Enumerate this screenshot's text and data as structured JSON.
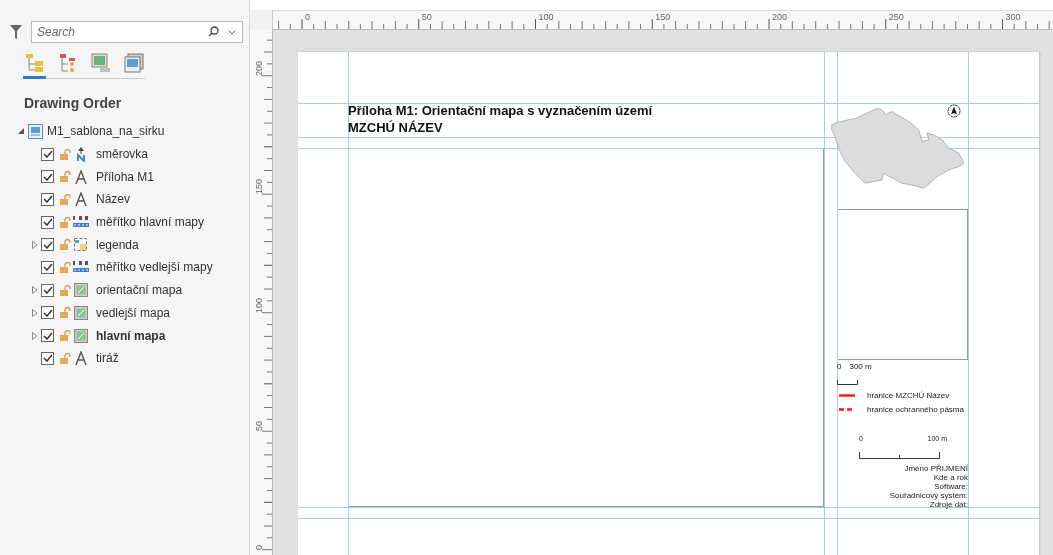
{
  "search": {
    "placeholder": "Search"
  },
  "view_tabs": [
    {
      "kind": "drawing-order",
      "selected": true
    },
    {
      "kind": "selection",
      "selected": false
    },
    {
      "kind": "map-view",
      "selected": false
    },
    {
      "kind": "layout-view",
      "selected": false
    }
  ],
  "section_title": "Drawing Order",
  "tree": {
    "label": "M1_sablona_na_sirku",
    "expanded": true,
    "children": [
      {
        "label": "směrovka",
        "kind": "north-arrow",
        "checked": true,
        "locked": false,
        "active": false
      },
      {
        "label": "Příloha M1",
        "kind": "text",
        "checked": true,
        "locked": false,
        "active": false
      },
      {
        "label": "Název",
        "kind": "text",
        "checked": true,
        "locked": false,
        "active": false
      },
      {
        "label": "měřítko hlavní mapy",
        "kind": "scalebar",
        "checked": true,
        "locked": false,
        "active": false
      },
      {
        "label": "legenda",
        "kind": "legend",
        "checked": true,
        "locked": false,
        "active": false,
        "expanded": false
      },
      {
        "label": "měřítko vedlejší mapy",
        "kind": "scalebar",
        "checked": true,
        "locked": false,
        "active": false
      },
      {
        "label": "orientační mapa",
        "kind": "map",
        "checked": true,
        "locked": false,
        "active": false,
        "expanded": false
      },
      {
        "label": "vedlejší mapa",
        "kind": "map",
        "checked": true,
        "locked": false,
        "active": false,
        "expanded": false
      },
      {
        "label": "hlavní mapa",
        "kind": "map",
        "checked": true,
        "locked": false,
        "active": true,
        "expanded": false
      },
      {
        "label": "tiráž",
        "kind": "text",
        "checked": true,
        "locked": false,
        "active": false
      }
    ]
  },
  "rulers": {
    "horizontal": [
      "0",
      "50",
      "100",
      "150",
      "200",
      "250",
      "300"
    ],
    "vertical": [
      "200",
      "150",
      "100",
      "50",
      "0"
    ]
  },
  "layout": {
    "title_lines": [
      "Příloha M1: Orientační mapa s vyznačením území",
      "MZCHÚ NÁZEV"
    ],
    "inset_scalebar": {
      "labels": [
        "0",
        "300 m"
      ]
    },
    "legend": [
      {
        "label": "hranice MZCHÚ Název",
        "kind": "solid"
      },
      {
        "label": "hranice ochranného pásma",
        "kind": "dashed"
      }
    ],
    "main_scalebar": {
      "labels": [
        "0",
        "100 m"
      ]
    },
    "imprint": [
      "Jméno PŘIJMENÍ",
      "Kde a rok",
      "Software:",
      "Souřadnicový systém:",
      "Zdroje dat:"
    ]
  }
}
